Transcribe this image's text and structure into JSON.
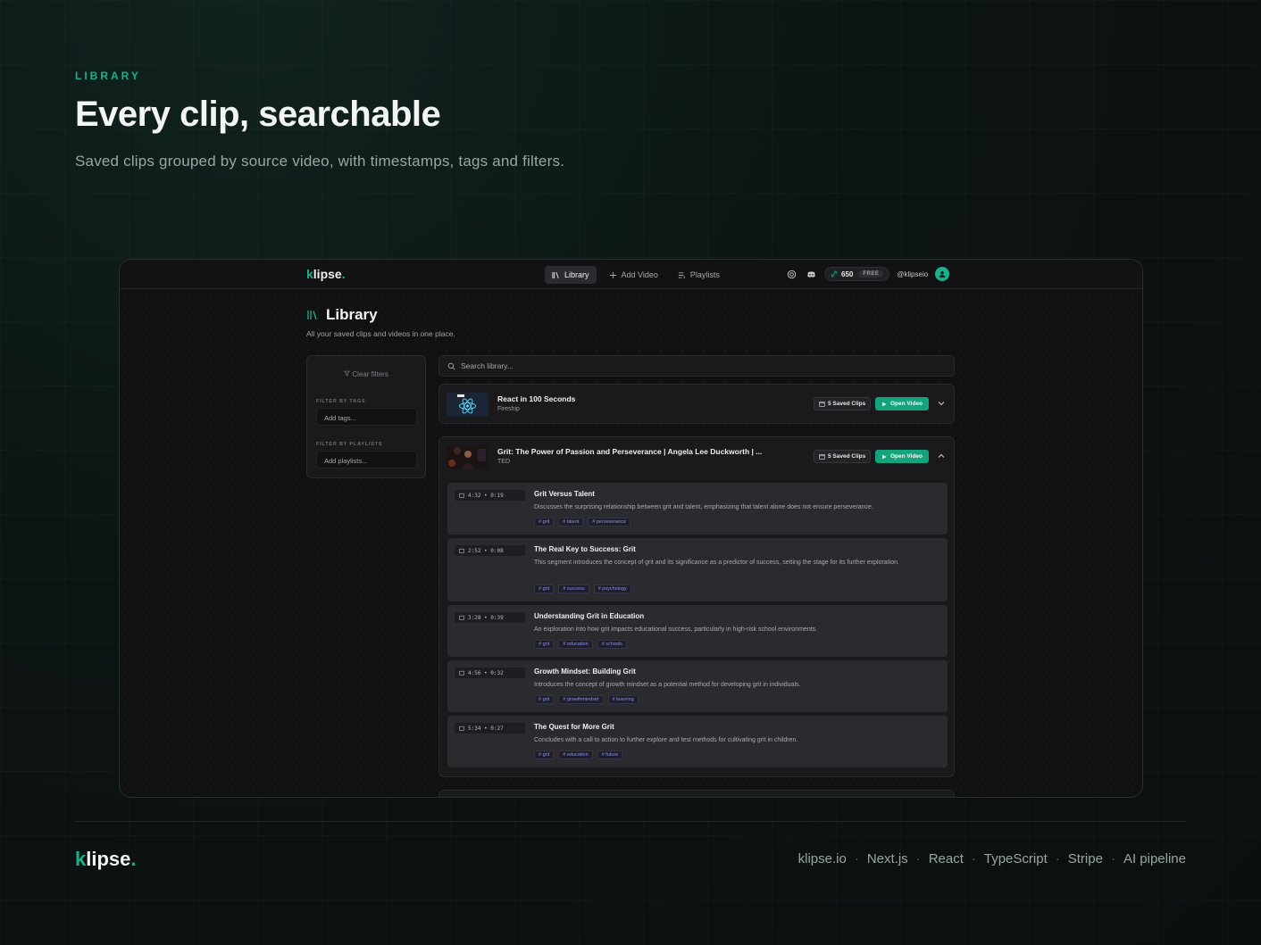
{
  "hero": {
    "eyebrow": "LIBRARY",
    "title": "Every clip, searchable",
    "subtitle": "Saved clips grouped by source video, with timestamps, tags and filters."
  },
  "app": {
    "logo": {
      "k": "k",
      "rest": "lipse",
      "dot": "."
    },
    "nav": {
      "library": "Library",
      "add_video": "Add Video",
      "playlists": "Playlists"
    },
    "credits": "650",
    "plan": "FREE",
    "username": "@klipseio",
    "page_title": "Library",
    "page_subtitle": "All your saved clips and videos in one place.",
    "filters": {
      "clear": "Clear filters",
      "tags_label": "FILTER BY TAGS",
      "tags_placeholder": "Add tags...",
      "playlists_label": "FILTER BY PLAYLISTS",
      "playlists_placeholder": "Add playlists..."
    },
    "search_placeholder": "Search library...",
    "videos": [
      {
        "title": "React in 100 Seconds",
        "channel": "Fireship",
        "saved": "5 Saved Clips",
        "open": "Open Video"
      },
      {
        "title": "Grit: The Power of Passion and Perseverance | Angela Lee Duckworth | ...",
        "channel": "TED",
        "saved": "5 Saved Clips",
        "open": "Open Video",
        "clips": [
          {
            "time": "4:32 • 0:19",
            "title": "Grit Versus Talent",
            "desc": "Discusses the surprising relationship between grit and talent, emphasizing that talent alone does not ensure perseverance.",
            "tags": [
              "# grit",
              "# talent",
              "# perseverance"
            ]
          },
          {
            "time": "2:52 • 0:08",
            "title": "The Real Key to Success: Grit",
            "desc": "This segment introduces the concept of grit and its significance as a predictor of success, setting the stage for its further exploration.",
            "tags": [
              "# grit",
              "# success",
              "# psychology"
            ]
          },
          {
            "time": "3:28 • 0:39",
            "title": "Understanding Grit in Education",
            "desc": "An exploration into how grit impacts educational success, particularly in high-risk school environments.",
            "tags": [
              "# grit",
              "# education",
              "# schools"
            ]
          },
          {
            "time": "4:56 • 0:32",
            "title": "Growth Mindset: Building Grit",
            "desc": "Introduces the concept of growth mindset as a potential method for developing grit in individuals.",
            "tags": [
              "# grit",
              "# growthmindset",
              "# learning"
            ]
          },
          {
            "time": "5:34 • 0:27",
            "title": "The Quest for More Grit",
            "desc": "Concludes with a call to action to further explore and test methods for cultivating grit in children.",
            "tags": [
              "# grit",
              "# education",
              "# future"
            ]
          }
        ]
      }
    ]
  },
  "footer": {
    "logo": {
      "k": "k",
      "rest": "lipse",
      "dot": "."
    },
    "links": [
      "klipse.io",
      "Next.js",
      "React",
      "TypeScript",
      "Stripe",
      "AI pipeline"
    ]
  },
  "colors": {
    "accent": "#18b38a",
    "button": "#13a37d",
    "tag_text": "#8b8fe6"
  },
  "icons": [
    "library-icon",
    "plus-icon",
    "playlist-icon",
    "support-icon",
    "discord-icon",
    "link-icon",
    "search-icon",
    "filter-icon",
    "chevron-down-icon",
    "chevron-up-icon",
    "play-icon",
    "clip-icon"
  ]
}
